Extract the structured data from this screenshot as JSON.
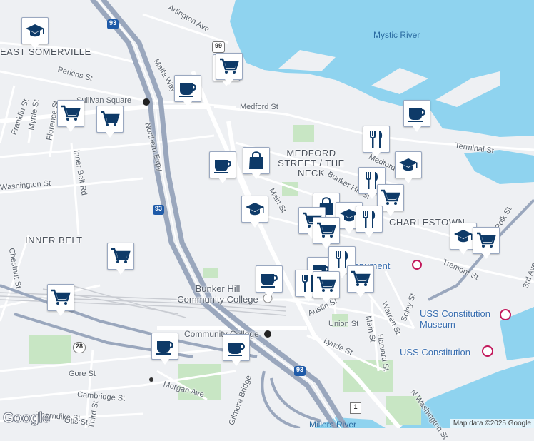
{
  "labels": {
    "neighborhoods": [
      "EAST SOMERVILLE",
      "INNER BELT",
      "MEDFORD STREET / THE NECK",
      "CHARLESTOWN"
    ],
    "water": [
      "Mystic River",
      "Millers River"
    ],
    "streets": [
      "Arlington Ave",
      "Perkins St",
      "Medford St",
      "Terminal St",
      "Sullivan Square",
      "Franklin St",
      "Myrtle St",
      "Florence St",
      "Inner Belt Rd",
      "Washington St",
      "Northern Expy",
      "Main St",
      "Bunker Hill St",
      "Polk St",
      "Tremont St",
      "Chestnut St",
      "Austin St",
      "Union St",
      "Warren St",
      "Soley St",
      "Main St",
      "Harvard St",
      "Lynde St",
      "Gore St",
      "Cambridge St",
      "Morgan Ave",
      "Otis St",
      "Thorndike St",
      "Third St",
      "Gilmore Bridge",
      "Community College",
      "Maffa Way",
      "3rd Ave",
      "N Washington St",
      "Medford"
    ],
    "pois": [
      "Bunker Hill Community College",
      "USS Constitution Museum",
      "USS Constitution",
      "Monument"
    ],
    "shields": [
      "93",
      "99",
      "93",
      "28",
      "93",
      "1"
    ]
  },
  "markers": [
    {
      "type": "school-icon"
    },
    {
      "type": "grocery-icon"
    },
    {
      "type": "grocery-icon"
    },
    {
      "type": "cafe-icon"
    },
    {
      "type": "grocery-icon"
    },
    {
      "type": "grocery-icon"
    },
    {
      "type": "cafe-icon"
    },
    {
      "type": "cafe-icon"
    },
    {
      "type": "shopping-icon"
    },
    {
      "type": "restaurant-icon"
    },
    {
      "type": "school-icon"
    },
    {
      "type": "restaurant-icon"
    },
    {
      "type": "grocery-icon"
    },
    {
      "type": "school-icon"
    },
    {
      "type": "shopping-icon"
    },
    {
      "type": "school-icon"
    },
    {
      "type": "restaurant-icon"
    },
    {
      "type": "school-icon"
    },
    {
      "type": "grocery-icon"
    },
    {
      "type": "grocery-icon"
    },
    {
      "type": "grocery-icon"
    },
    {
      "type": "cafe-icon"
    },
    {
      "type": "restaurant-icon"
    },
    {
      "type": "grocery-icon"
    },
    {
      "type": "grocery-icon"
    },
    {
      "type": "cafe-icon"
    },
    {
      "type": "cafe-icon"
    },
    {
      "type": "cafe-icon"
    },
    {
      "type": "restaurant-icon"
    },
    {
      "type": "grocery-icon"
    },
    {
      "type": "grocery-icon"
    }
  ],
  "attribution": {
    "logo": "Google",
    "text": "Map data ©2025 Google"
  },
  "colors": {
    "water": "#8fd3ef",
    "land": "#eef0f3",
    "park": "#c8e6c4",
    "highway": "#9aa7bd",
    "marker_icon": "#0e3a68"
  }
}
